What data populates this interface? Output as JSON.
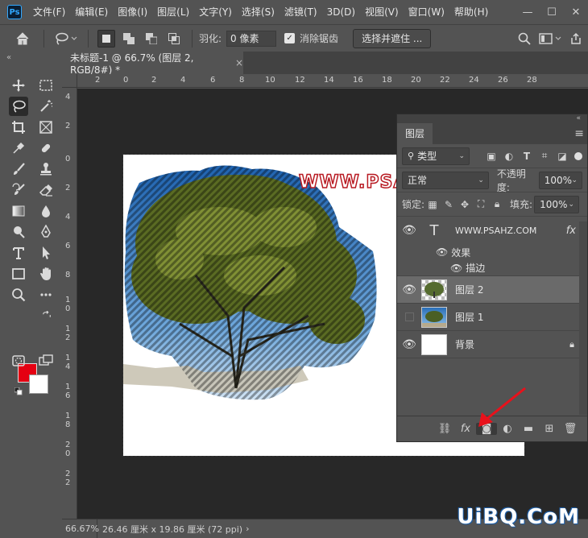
{
  "app": {
    "logo_text": "Ps"
  },
  "menu": [
    "文件(F)",
    "编辑(E)",
    "图像(I)",
    "图层(L)",
    "文字(Y)",
    "选择(S)",
    "滤镜(T)",
    "3D(D)",
    "视图(V)",
    "窗口(W)",
    "帮助(H)"
  ],
  "window_controls": {
    "minimize": "—",
    "maximize": "☐",
    "close": "✕"
  },
  "options": {
    "feather_label": "羽化:",
    "feather_value": "0 像素",
    "antialias_label": "消除锯齿",
    "antialias_checked": true,
    "select_mask_label": "选择并遮住 ..."
  },
  "document": {
    "tab_title": "未标题-1 @ 66.7% (图层 2, RGB/8#) *",
    "close_glyph": "×",
    "watermark": "WWW.PSA"
  },
  "ruler": {
    "top": [
      "2",
      "0",
      "2",
      "4",
      "6",
      "8",
      "10",
      "12",
      "14",
      "16",
      "18",
      "20",
      "22",
      "24",
      "26",
      "28"
    ],
    "left": [
      "4",
      "2",
      "0",
      "2",
      "4",
      "6",
      "8",
      "1\n0",
      "1\n2",
      "1\n4",
      "1\n6",
      "1\n8",
      "2\n0",
      "2\n2"
    ]
  },
  "status": {
    "zoom": "66.67%",
    "doc_size": "26.46 厘米 x 19.86 厘米 (72 ppi)",
    "chevron": "›"
  },
  "site_logo": "UiBQ.CoM",
  "colors": {
    "foreground": "#e50012",
    "background": "#ffffff",
    "accent": "#31a8ff"
  },
  "layers_panel": {
    "tab": "图层",
    "filter_label": "类型",
    "blend_mode": "正常",
    "opacity_label": "不透明度:",
    "opacity_value": "100%",
    "lock_label": "锁定:",
    "fill_label": "填充:",
    "fill_value": "100%",
    "layers": [
      {
        "name": "WWW.PSAHZ.COM",
        "type": "text",
        "visible": true,
        "fx": "fx"
      },
      {
        "name": "图层 2",
        "type": "image",
        "visible": true,
        "selected": true
      },
      {
        "name": "图层 1",
        "type": "image",
        "visible": false
      },
      {
        "name": "背景",
        "type": "background",
        "visible": true,
        "locked": true
      }
    ],
    "effects_label": "效果",
    "stroke_label": "描边"
  }
}
